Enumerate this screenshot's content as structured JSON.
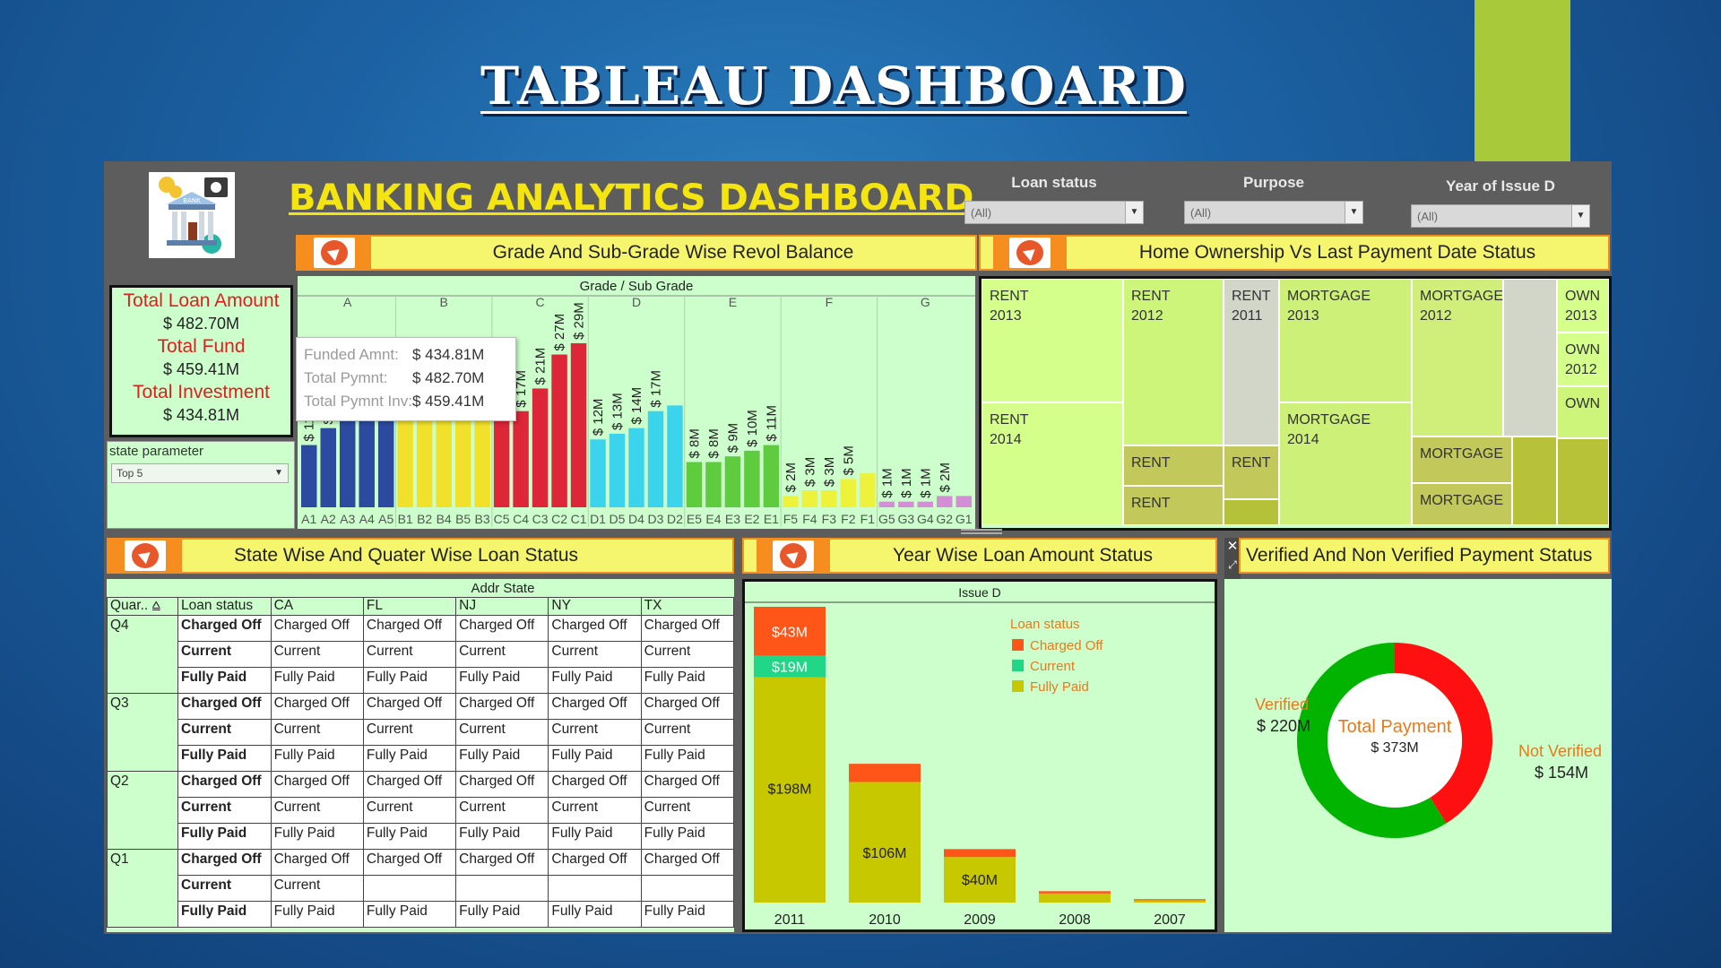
{
  "slide": {
    "title": "TABLEAU DASHBOARD"
  },
  "dashboard": {
    "title": "BANKING ANALYTICS DASHBOARD",
    "filters": [
      {
        "label": "Loan status",
        "value": "(All)"
      },
      {
        "label": "Purpose",
        "value": "(All)"
      },
      {
        "label": "Year of Issue D",
        "value": "(All)"
      }
    ],
    "logo_text": "BANK"
  },
  "kpi": {
    "total_loan_label": "Total Loan Amount",
    "total_loan_value": "$ 482.70M",
    "total_fund_label": "Total Fund",
    "total_fund_value": "$ 459.41M",
    "total_invest_label": "Total Investment",
    "total_invest_value": "$ 434.81M"
  },
  "state_parameter": {
    "label": "state parameter",
    "value": "Top 5"
  },
  "grade_chart": {
    "header": "Grade And Sub-Grade Wise Revol Balance",
    "axis_title": "Grade / Sub Grade",
    "grades": [
      "A",
      "B",
      "C",
      "D",
      "E",
      "F",
      "G"
    ],
    "tooltip": {
      "rows": [
        {
          "label": "Funded Amnt:",
          "value": "$ 434.81M"
        },
        {
          "label": "Total Pymnt:",
          "value": "$ 482.70M"
        },
        {
          "label": "Total Pymnt Inv:",
          "value": "$ 459.41M"
        }
      ]
    }
  },
  "chart_data": [
    {
      "type": "bar",
      "title": "Grade And Sub-Grade Wise Revol Balance",
      "xlabel": "Grade / Sub Grade",
      "groups": [
        "A",
        "B",
        "C",
        "D",
        "E",
        "F",
        "G"
      ],
      "categories": [
        "A1",
        "A2",
        "A3",
        "A4",
        "A5",
        "B1",
        "B2",
        "B4",
        "B5",
        "B3",
        "C5",
        "C4",
        "C3",
        "C2",
        "C1",
        "D1",
        "D5",
        "D4",
        "D3",
        "D2",
        "E5",
        "E4",
        "E3",
        "E2",
        "E1",
        "F5",
        "F4",
        "F3",
        "F2",
        "F1",
        "G5",
        "G3",
        "G4",
        "G2",
        "G1"
      ],
      "values": [
        11,
        14,
        20,
        25,
        25,
        20,
        23,
        24,
        25,
        25,
        16,
        17,
        21,
        27,
        29,
        12,
        13,
        14,
        17,
        18,
        8,
        8,
        9,
        10,
        11,
        2,
        3,
        3,
        5,
        6,
        1,
        1,
        1,
        2,
        2
      ],
      "labels": [
        "$ 11M",
        "$ 14M",
        "$ 2",
        "",
        "",
        "",
        "",
        "",
        "",
        "",
        "$ 16",
        "$ 17M",
        "$ 21M",
        "$ 27M",
        "$ 29M",
        "$ 12M",
        "$ 13M",
        "$ 14M",
        "$ 17M",
        "",
        "$ 8M",
        "$ 8M",
        "$ 9M",
        "$ 10M",
        "$ 11M",
        "$ 2M",
        "$ 3M",
        "$ 3M",
        "$ 5M",
        "",
        "$ 1M",
        "$ 1M",
        "$ 1M",
        "$ 2M",
        ""
      ],
      "colors": [
        "#2c4aa0",
        "#2c4aa0",
        "#2c4aa0",
        "#2c4aa0",
        "#2c4aa0",
        "#f2e12a",
        "#f2e12a",
        "#f2e12a",
        "#f2e12a",
        "#f2e12a",
        "#dd2638",
        "#dd2638",
        "#dd2638",
        "#dd2638",
        "#dd2638",
        "#3cd4ec",
        "#3cd4ec",
        "#3cd4ec",
        "#3cd4ec",
        "#3cd4ec",
        "#5fcc3f",
        "#5fcc3f",
        "#5fcc3f",
        "#5fcc3f",
        "#5fcc3f",
        "#eef23a",
        "#eef23a",
        "#eef23a",
        "#eef23a",
        "#eef23a",
        "#d48ed6",
        "#d48ed6",
        "#d48ed6",
        "#d48ed6",
        "#d48ed6"
      ],
      "unit": "$M"
    },
    {
      "type": "bar",
      "title": "Year Wise Loan Amount Status",
      "xlabel": "Issue D",
      "categories": [
        "2011",
        "2010",
        "2009",
        "2008",
        "2007"
      ],
      "series": [
        {
          "name": "Fully Paid",
          "values": [
            198,
            106,
            40,
            8,
            2
          ]
        },
        {
          "name": "Current",
          "values": [
            19,
            0,
            0,
            0,
            0
          ]
        },
        {
          "name": "Charged Off",
          "values": [
            43,
            16,
            7,
            2,
            1
          ]
        }
      ],
      "data_labels": {
        "2011": [
          "$198M",
          "$19M",
          "$43M"
        ],
        "2010": [
          "$106M"
        ],
        "2009": [
          "$40M"
        ]
      },
      "colors": {
        "Fully Paid": "#c8c800",
        "Current": "#22d688",
        "Charged Off": "#ff5519"
      },
      "legend_title": "Loan status",
      "legend_position": "top-right"
    },
    {
      "type": "pie",
      "title": "Verified And Non Verified Payment Status",
      "center_label": "Total Payment",
      "center_value": "$ 373M",
      "slices": [
        {
          "name": "Verified",
          "value": 220,
          "label": "$ 220M",
          "color": "#00b400"
        },
        {
          "name": "Not Verified",
          "value": 154,
          "label": "$ 154M",
          "color": "#ff1010"
        }
      ]
    }
  ],
  "home_chart": {
    "header": "Home Ownership Vs Last Payment Date Status",
    "cells": [
      {
        "t1": "RENT",
        "t2": "2013"
      },
      {
        "t1": "RENT",
        "t2": "2014"
      },
      {
        "t1": "RENT",
        "t2": "2012"
      },
      {
        "t1": "RENT",
        "t2": ""
      },
      {
        "t1": "RENT",
        "t2": ""
      },
      {
        "t1": "RENT",
        "t2": "2011"
      },
      {
        "t1": "RENT",
        "t2": ""
      },
      {
        "t1": "MORTGAGE",
        "t2": "2013"
      },
      {
        "t1": "MORTGAGE",
        "t2": "2014"
      },
      {
        "t1": "MORTGAGE",
        "t2": "2012"
      },
      {
        "t1": "MORTGAGE",
        "t2": ""
      },
      {
        "t1": "MORTGAGE",
        "t2": ""
      },
      {
        "t1": "OWN",
        "t2": "2013"
      },
      {
        "t1": "OWN",
        "t2": "2012"
      },
      {
        "t1": "OWN",
        "t2": ""
      }
    ]
  },
  "state_table": {
    "header": "State Wise And Quater Wise Loan Status",
    "addr_title": "Addr State",
    "col_quarter": "Quar..",
    "col_status": "Loan status",
    "states": [
      "CA",
      "FL",
      "NJ",
      "NY",
      "TX"
    ],
    "rows": [
      {
        "q": "Q4",
        "status": "Charged Off",
        "cells": [
          "Charged Off",
          "Charged Off",
          "Charged Off",
          "Charged Off",
          "Charged Off"
        ]
      },
      {
        "q": "",
        "status": "Current",
        "cells": [
          "Current",
          "Current",
          "Current",
          "Current",
          "Current"
        ]
      },
      {
        "q": "",
        "status": "Fully Paid",
        "cells": [
          "Fully Paid",
          "Fully Paid",
          "Fully Paid",
          "Fully Paid",
          "Fully Paid"
        ]
      },
      {
        "q": "Q3",
        "status": "Charged Off",
        "cells": [
          "Charged Off",
          "Charged Off",
          "Charged Off",
          "Charged Off",
          "Charged Off"
        ]
      },
      {
        "q": "",
        "status": "Current",
        "cells": [
          "Current",
          "Current",
          "Current",
          "Current",
          "Current"
        ]
      },
      {
        "q": "",
        "status": "Fully Paid",
        "cells": [
          "Fully Paid",
          "Fully Paid",
          "Fully Paid",
          "Fully Paid",
          "Fully Paid"
        ]
      },
      {
        "q": "Q2",
        "status": "Charged Off",
        "cells": [
          "Charged Off",
          "Charged Off",
          "Charged Off",
          "Charged Off",
          "Charged Off"
        ]
      },
      {
        "q": "",
        "status": "Current",
        "cells": [
          "Current",
          "Current",
          "Current",
          "Current",
          "Current"
        ]
      },
      {
        "q": "",
        "status": "Fully Paid",
        "cells": [
          "Fully Paid",
          "Fully Paid",
          "Fully Paid",
          "Fully Paid",
          "Fully Paid"
        ]
      },
      {
        "q": "Q1",
        "status": "Charged Off",
        "cells": [
          "Charged Off",
          "Charged Off",
          "Charged Off",
          "Charged Off",
          "Charged Off"
        ]
      },
      {
        "q": "",
        "status": "Current",
        "cells": [
          "Current",
          "",
          "",
          "",
          ""
        ]
      },
      {
        "q": "",
        "status": "Fully Paid",
        "cells": [
          "Fully Paid",
          "Fully Paid",
          "Fully Paid",
          "Fully Paid",
          "Fully Paid"
        ]
      }
    ]
  },
  "year_chart": {
    "header": "Year Wise Loan Amount Status",
    "axis_title": "Issue D",
    "legend_title": "Loan status",
    "legend": [
      "Charged Off",
      "Current",
      "Fully Paid"
    ]
  },
  "verify_chart": {
    "header": "Verified And Non Verified Payment Status",
    "verified_label": "Verified",
    "verified_value": "$ 220M",
    "not_verified_label": "Not Verified",
    "not_verified_value": "$ 154M",
    "center_label": "Total Payment",
    "center_value": "$ 373M"
  },
  "toolbar_icons": [
    "close-icon",
    "expand-icon",
    "filter-icon",
    "more-icon"
  ]
}
